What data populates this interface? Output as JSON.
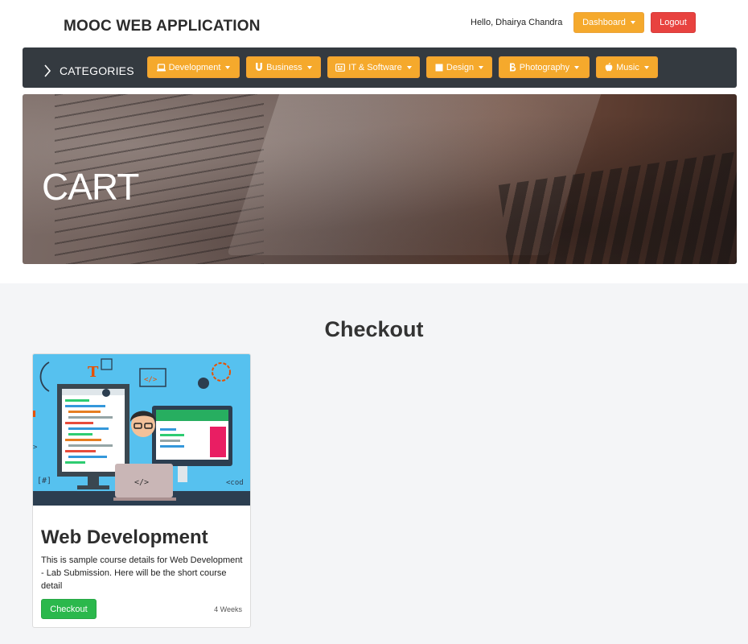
{
  "header": {
    "title": "MOOC WEB APPLICATION",
    "greeting": "Hello, Dhairya Chandra",
    "dashboard_label": "Dashboard",
    "logout_label": "Logout"
  },
  "navbar": {
    "categories_label": "CATEGORIES",
    "items": [
      {
        "label": "Development",
        "icon": "laptop-icon"
      },
      {
        "label": "Business",
        "icon": "magnet-icon"
      },
      {
        "label": "IT & Software",
        "icon": "keyboard-icon"
      },
      {
        "label": "Design",
        "icon": "square-icon"
      },
      {
        "label": "Photography",
        "icon": "bitcoin-icon"
      },
      {
        "label": "Music",
        "icon": "apple-icon"
      }
    ]
  },
  "hero": {
    "title": "CART"
  },
  "main": {
    "heading": "Checkout",
    "cards": [
      {
        "title": "Web Development",
        "description": "This is sample course details for Web Development - Lab Submission. Here will be the short course detail",
        "button_label": "Checkout",
        "duration": "4 Weeks"
      }
    ]
  },
  "colors": {
    "accent": "#f5a92c",
    "danger": "#e8423f",
    "success": "#2bb84c",
    "navbar": "#343a40"
  }
}
